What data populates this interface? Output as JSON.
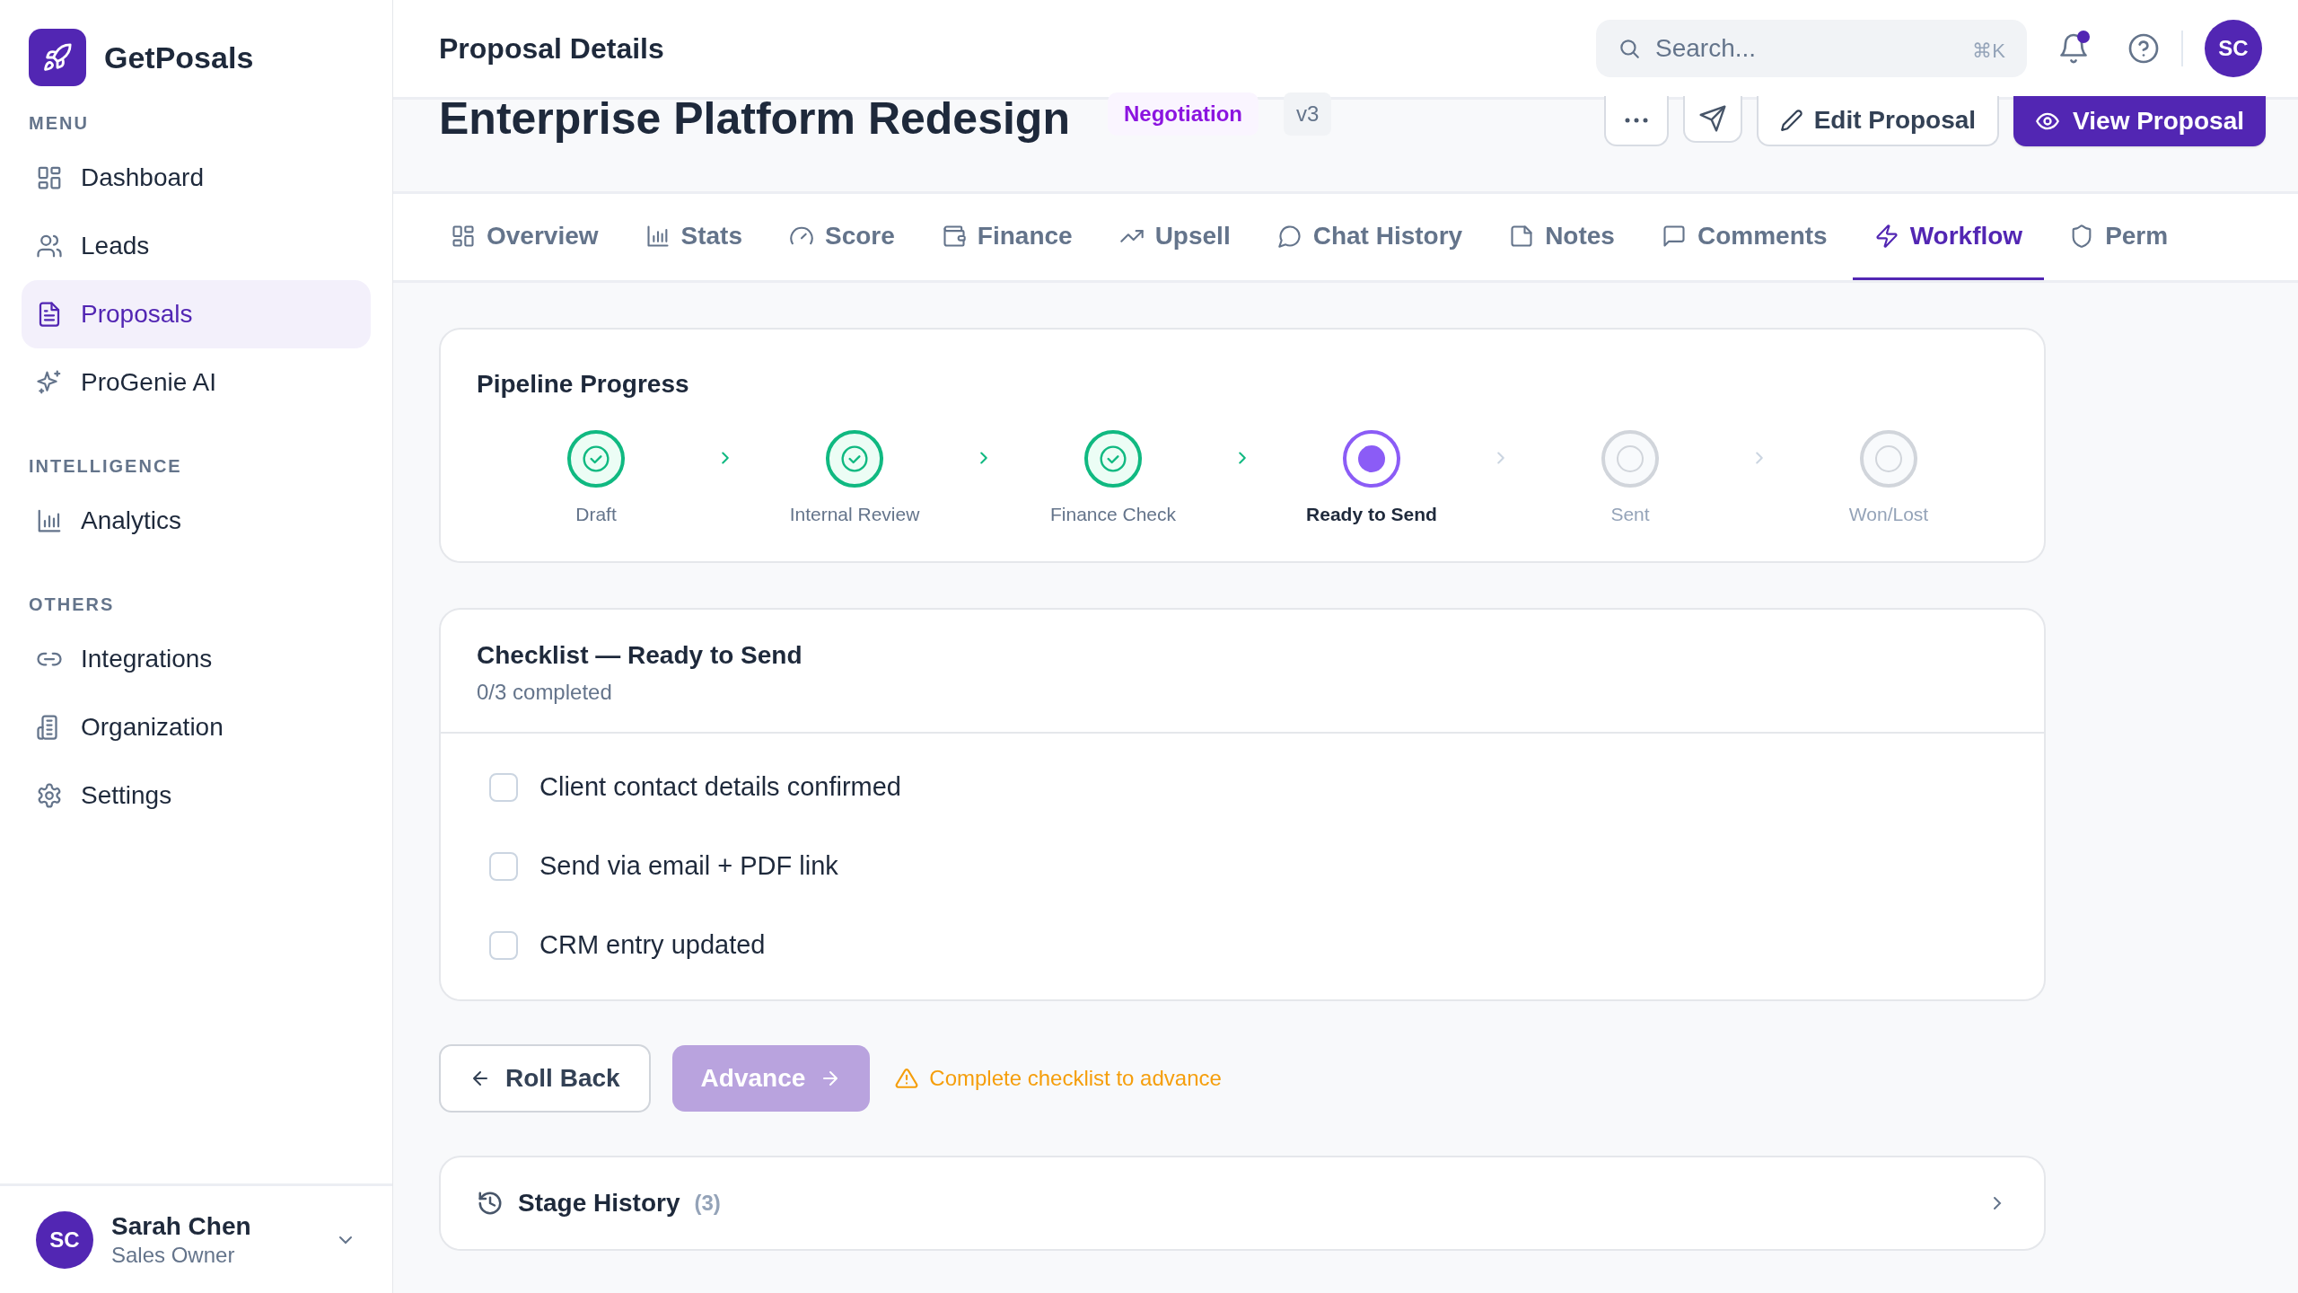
{
  "sidebar": {
    "brand": "GetPosals",
    "sections": [
      {
        "label": "MENU",
        "items": [
          {
            "label": "Dashboard",
            "selected": false
          },
          {
            "label": "Leads",
            "selected": false
          },
          {
            "label": "Proposals",
            "selected": true
          },
          {
            "label": "ProGenie AI",
            "selected": false
          }
        ]
      },
      {
        "label": "INTELLIGENCE",
        "items": [
          {
            "label": "Analytics",
            "selected": false
          }
        ]
      },
      {
        "label": "OTHERS",
        "items": [
          {
            "label": "Integrations",
            "selected": false
          },
          {
            "label": "Organization",
            "selected": false
          },
          {
            "label": "Settings",
            "selected": false
          }
        ]
      }
    ],
    "user": {
      "initials": "SC",
      "name": "Sarah Chen",
      "role": "Sales Owner"
    }
  },
  "header": {
    "title": "Proposal Details",
    "search": {
      "placeholder": "Search...",
      "shortcut": "⌘K"
    },
    "notifications_unread": true,
    "avatar": "SC"
  },
  "proposal": {
    "title": "Enterprise Platform Redesign",
    "status": "Negotiation",
    "version": "v3",
    "actions": [
      "Edit Proposal",
      "View Proposal"
    ]
  },
  "tabs": [
    {
      "label": "Overview",
      "selected": false
    },
    {
      "label": "Stats",
      "selected": false
    },
    {
      "label": "Score",
      "selected": false
    },
    {
      "label": "Finance",
      "selected": false
    },
    {
      "label": "Upsell",
      "selected": false
    },
    {
      "label": "Chat History",
      "selected": false
    },
    {
      "label": "Notes",
      "selected": false
    },
    {
      "label": "Comments",
      "selected": false
    },
    {
      "label": "Workflow",
      "selected": true
    },
    {
      "label": "Perm",
      "selected": false
    }
  ],
  "pipeline": {
    "title": "Pipeline Progress",
    "stages": [
      {
        "label": "Draft",
        "kind": "done"
      },
      {
        "label": "Internal Review",
        "kind": "done"
      },
      {
        "label": "Finance Check",
        "kind": "done"
      },
      {
        "label": "Ready to Send",
        "kind": "current"
      },
      {
        "label": "Sent",
        "kind": "upcoming"
      },
      {
        "label": "Won/Lost",
        "kind": "upcoming"
      }
    ]
  },
  "checklist": {
    "title": "Checklist — Ready to Send",
    "progress": "0/3 completed",
    "items": [
      {
        "label": "Client contact details confirmed",
        "checked": false
      },
      {
        "label": "Send via email + PDF link",
        "checked": false
      },
      {
        "label": "CRM entry updated",
        "checked": false
      }
    ]
  },
  "workflow_actions": {
    "roll_back": {
      "label": "Roll Back",
      "disabled": false
    },
    "advance": {
      "label": "Advance",
      "disabled": true
    },
    "warning": "Complete checklist to advance"
  },
  "stage_history": {
    "title": "Stage History",
    "count": "(3)",
    "expanded": false
  }
}
